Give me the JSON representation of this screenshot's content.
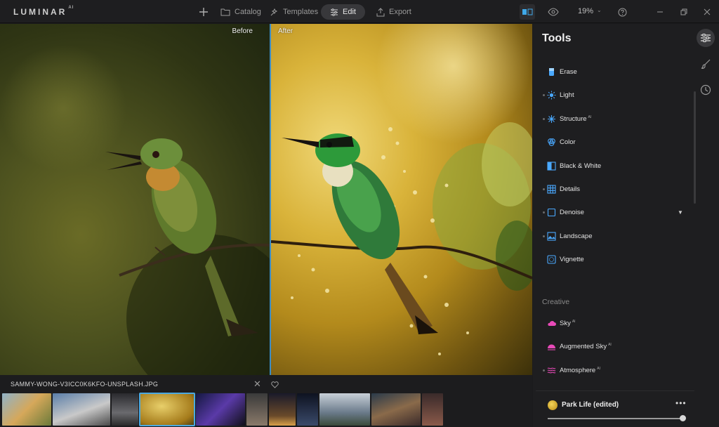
{
  "app": {
    "logo": "LUMINAR",
    "logo_sup": "AI"
  },
  "nav": {
    "catalog": "Catalog",
    "templates": "Templates",
    "edit": "Edit",
    "export": "Export"
  },
  "view": {
    "zoom": "19%"
  },
  "photo": {
    "before_label": "Before",
    "after_label": "After",
    "filename": "SAMMY-WONG-V3ICC0K6KFO-UNSPLASH.JPG"
  },
  "panel": {
    "title": "Tools",
    "tools": [
      {
        "label": "Erase",
        "ai": "",
        "icon": "erase-icon",
        "color": "#4aa9ff",
        "has_dot": false
      },
      {
        "label": "Light",
        "ai": "",
        "icon": "sun-icon",
        "color": "#4aa9ff",
        "has_dot": true
      },
      {
        "label": "Structure",
        "ai": "AI",
        "icon": "structure-icon",
        "color": "#4aa9ff",
        "has_dot": true
      },
      {
        "label": "Color",
        "ai": "",
        "icon": "color-icon",
        "color": "#4aa9ff",
        "has_dot": false
      },
      {
        "label": "Black & White",
        "ai": "",
        "icon": "black-white-icon",
        "color": "#4aa9ff",
        "has_dot": false
      },
      {
        "label": "Details",
        "ai": "",
        "icon": "details-icon",
        "color": "#4aa9ff",
        "has_dot": true
      },
      {
        "label": "Denoise",
        "ai": "",
        "icon": "denoise-icon",
        "color": "#4aa9ff",
        "has_dot": true
      },
      {
        "label": "Landscape",
        "ai": "",
        "icon": "landscape-icon",
        "color": "#4aa9ff",
        "has_dot": true
      },
      {
        "label": "Vignette",
        "ai": "",
        "icon": "vignette-icon",
        "color": "#4aa9ff",
        "has_dot": false
      }
    ],
    "creative_title": "Creative",
    "creative_tools": [
      {
        "label": "Sky",
        "ai": "AI",
        "icon": "sky-icon",
        "color": "#e84ab8",
        "has_dot": false
      },
      {
        "label": "Augmented Sky",
        "ai": "AI",
        "icon": "augmented-sky-icon",
        "color": "#e84ab8",
        "has_dot": false
      },
      {
        "label": "Atmosphere",
        "ai": "AI",
        "icon": "atmosphere-icon",
        "color": "#e84ab8",
        "has_dot": true
      }
    ],
    "preset": {
      "name": "Park Life (edited)",
      "more": "•••",
      "amount": 1.0
    }
  },
  "colors": {
    "accent": "#4ba9e0",
    "tool_blue": "#4aa9ff",
    "creative_pink": "#e84ab8"
  }
}
